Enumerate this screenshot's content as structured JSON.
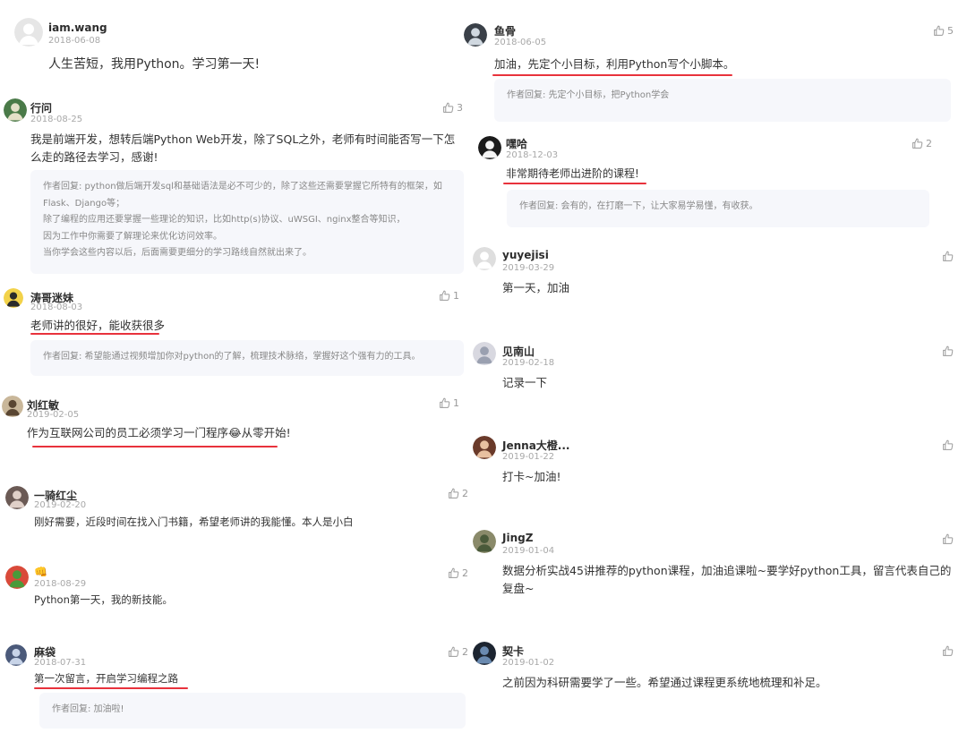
{
  "colors": {
    "underline": "#e8323c",
    "reply_bg": "#f6f7fb",
    "date": "#a8a8a8"
  },
  "like_icon": "thumbs-up-icon",
  "left_comments": [
    {
      "name": "iam.wang",
      "date": "2018-06-08",
      "likes": "",
      "content": "人生苦短，我用Python。学习第一天!",
      "reply": []
    },
    {
      "name": "行问",
      "date": "2018-08-25",
      "likes": "3",
      "content": "我是前端开发，想转后端Python Web开发，除了SQL之外，老师有时间能否写一下怎么走的路径去学习，感谢!",
      "reply": [
        "作者回复: python做后端开发sql和基础语法是必不可少的，除了这些还需要掌握它所特有的框架，如Flask、Django等；",
        "除了编程的应用还要掌握一些理论的知识，比如http(s)协议、uWSGI、nginx整合等知识，",
        "因为工作中你需要了解理论来优化访问效率。",
        "当你学会这些内容以后，后面需要更细分的学习路线自然就出来了。"
      ]
    },
    {
      "name": "涛哥迷妹",
      "date": "2018-08-03",
      "likes": "1",
      "content": "老师讲的很好，能收获很多",
      "reply": [
        "作者回复: 希望能通过视频增加你对python的了解，梳理技术脉络，掌握好这个强有力的工具。"
      ]
    },
    {
      "name": "刘红敏",
      "date": "2019-02-05",
      "likes": "1",
      "content": "作为互联网公司的员工必须学习一门程序😂从零开始!",
      "reply": []
    },
    {
      "name": "一骑红尘",
      "date": "2019-02-20",
      "likes": "2",
      "content": "刚好需要，近段时间在找入门书籍，希望老师讲的我能懂。本人是小白",
      "reply": []
    },
    {
      "name": "👊",
      "date": "2018-08-29",
      "likes": "2",
      "content": "Python第一天，我的新技能。",
      "reply": []
    },
    {
      "name": "麻袋",
      "date": "2018-07-31",
      "likes": "2",
      "content": "第一次留言，开启学习编程之路",
      "reply": [
        "作者回复: 加油啦!"
      ]
    }
  ],
  "right_comments": [
    {
      "name": "鱼骨",
      "date": "2018-06-05",
      "likes": "5",
      "content": "加油，先定个小目标，利用Python写个小脚本。",
      "reply": [
        "作者回复: 先定个小目标，把Python学会"
      ]
    },
    {
      "name": "嘿哈",
      "date": "2018-12-03",
      "likes": "2",
      "content": "非常期待老师出进阶的课程!",
      "reply": [
        "作者回复: 会有的，在打磨一下，让大家易学易懂，有收获。"
      ]
    },
    {
      "name": "yuyejisi",
      "date": "2019-03-29",
      "likes": "",
      "content": "第一天，加油",
      "reply": []
    },
    {
      "name": "见南山",
      "date": "2019-02-18",
      "likes": "",
      "content": "记录一下",
      "reply": []
    },
    {
      "name": "Jenna大橙...",
      "date": "2019-01-22",
      "likes": "",
      "content": "打卡~加油!",
      "reply": []
    },
    {
      "name": "JingZ",
      "date": "2019-01-04",
      "likes": "",
      "content": "数据分析实战45讲推荐的python课程，加油追课啦~要学好python工具，留言代表自己的复盘~",
      "reply": []
    },
    {
      "name": "契卡",
      "date": "2019-01-02",
      "likes": "",
      "content": "之前因为科研需要学了一些。希望通过课程更系统地梳理和补足。",
      "reply": []
    }
  ]
}
